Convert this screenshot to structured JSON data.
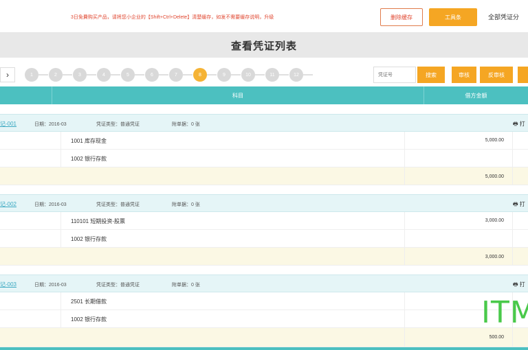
{
  "topbar": {
    "notice": "3日免費购买产品，请将您小企业的【Shift+Ctrl+Delete】清楚缓存，如发不需要缓存说明，升级",
    "outline_button": "删除缓存",
    "orange_button": "工具条",
    "right_link": "全部凭证分"
  },
  "page_title": "查看凭证列表",
  "pager": {
    "prev": "›",
    "steps": [
      "1",
      "2",
      "3",
      "4",
      "5",
      "6",
      "7",
      "8",
      "9",
      "10",
      "11",
      "12"
    ],
    "active_step": "8",
    "search_placeholder": "凭证号",
    "search_button": "搜索",
    "actions": [
      "审核",
      "反审核",
      ""
    ]
  },
  "table": {
    "columns": [
      "",
      "科目",
      "借方金额"
    ]
  },
  "vouchers": [
    {
      "no": "记-001",
      "date": "日期：2016-03",
      "type": "凭证类型：普通凭证",
      "attach": "附单据：0 张",
      "print": "🖶 打",
      "rows": [
        {
          "account": "1001 库存现金",
          "debit": "5,000.00"
        },
        {
          "account": "1002 银行存款",
          "debit": ""
        }
      ],
      "total": "5,000.00"
    },
    {
      "no": "记-002",
      "date": "日期：2016-03",
      "type": "凭证类型：普通凭证",
      "attach": "附单据：0 张",
      "print": "🖶 打",
      "rows": [
        {
          "account": "110101 短期投资-股票",
          "debit": "3,000.00"
        },
        {
          "account": "1002 银行存款",
          "debit": ""
        }
      ],
      "total": "3,000.00"
    },
    {
      "no": "记-003",
      "date": "日期：2016-03",
      "type": "凭证类型：普通凭证",
      "attach": "附单据：0 张",
      "print": "🖶 打",
      "rows": [
        {
          "account": "2501 长期借款",
          "debit": ""
        },
        {
          "account": "1002 银行存款",
          "debit": ""
        }
      ],
      "total": "500.00"
    }
  ],
  "watermark": "ITM"
}
